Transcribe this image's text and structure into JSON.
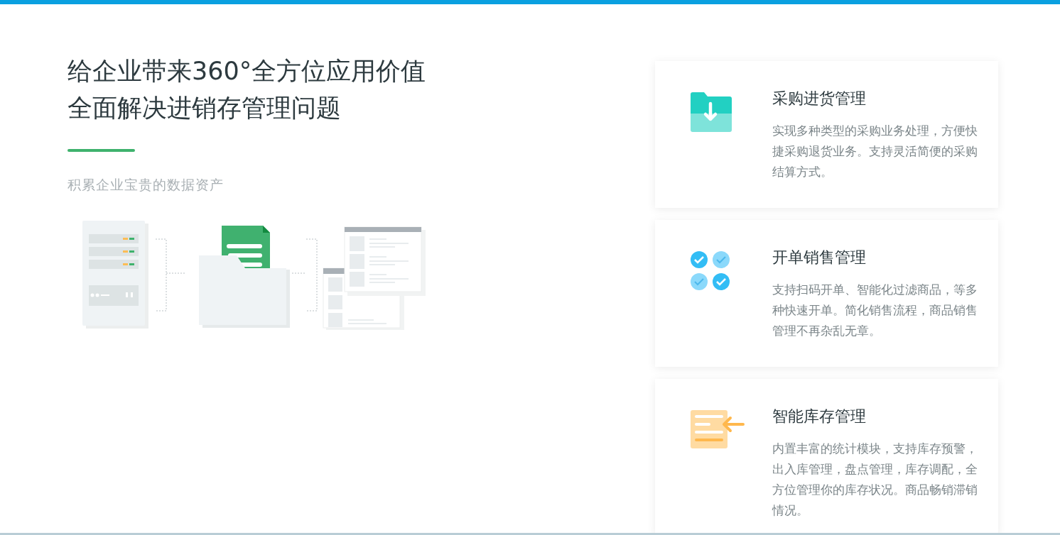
{
  "hero": {
    "headline_lines": [
      "给企业带来360°全方位应用价值",
      "全面解决进销存管理问题"
    ],
    "subtitle": "积累企业宝贵的数据资产"
  },
  "features": [
    {
      "kind": "purchase",
      "title": "采购进货管理",
      "description": "实现多种类型的采购业务处理，方便快捷采购退货业务。支持灵活简便的采购结算方式。"
    },
    {
      "kind": "sales",
      "title": "开单销售管理",
      "description": "支持扫码开单、智能化过滤商品，等多种快速开单。简化销售流程，商品销售管理不再杂乱无章。"
    },
    {
      "kind": "inventory",
      "title": "智能库存管理",
      "description": "内置丰富的统计模块，支持库存预警，出入库管理，盘点管理，库存调配，全方位管理你的库存状况。商品畅销滞销情况。"
    }
  ]
}
